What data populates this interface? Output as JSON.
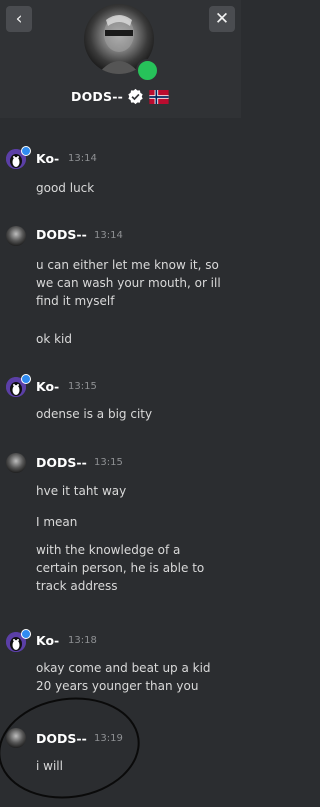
{
  "header": {
    "back_label": "‹",
    "close_label": "✕",
    "username": "DODS--"
  },
  "messages": [
    {
      "sender": "Ko-",
      "time": "13:14",
      "lines": [
        "good luck"
      ]
    },
    {
      "sender": "DODS--",
      "time": "13:14",
      "lines": [
        "u can either let me know it, so we can wash your mouth, or ill find it myself",
        "ok kid"
      ]
    },
    {
      "sender": "Ko-",
      "time": "13:15",
      "lines": [
        "odense is a big city"
      ]
    },
    {
      "sender": "DODS--",
      "time": "13:15",
      "lines": [
        "hve it taht way",
        "I mean",
        "with the knowledge of a certain person, he is able to track address"
      ]
    },
    {
      "sender": "Ko-",
      "time": "13:18",
      "lines": [
        "okay come and beat up a kid 20 years younger than you"
      ]
    },
    {
      "sender": "DODS--",
      "time": "13:19",
      "lines": [
        "i will"
      ]
    }
  ],
  "colors": {
    "online": "#27c25a",
    "verified": "#ffffff",
    "flag_red": "#ba0c2f",
    "flag_blue": "#00205b"
  },
  "icons": {
    "back": "chevron-left-icon",
    "close": "close-icon",
    "verified": "verified-badge-icon",
    "flag": "norway-flag-icon"
  }
}
